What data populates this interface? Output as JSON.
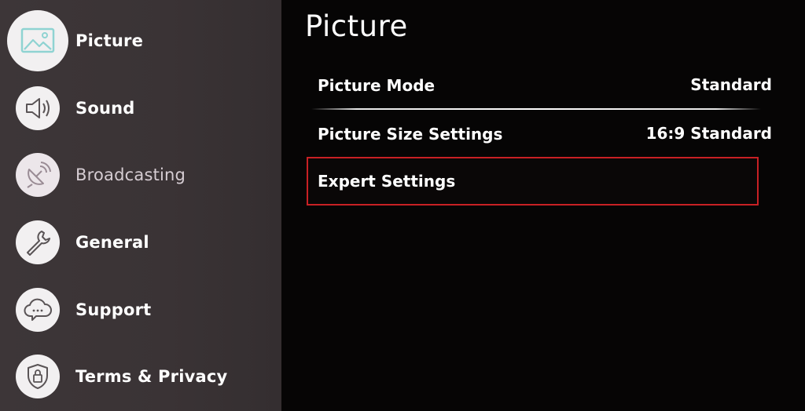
{
  "sidebar": {
    "items": [
      {
        "label": "Picture",
        "icon": "picture-icon",
        "state": "active"
      },
      {
        "label": "Sound",
        "icon": "speaker-icon",
        "state": "normal"
      },
      {
        "label": "Broadcasting",
        "icon": "satellite-dish-icon",
        "state": "dim"
      },
      {
        "label": "General",
        "icon": "wrench-icon",
        "state": "normal"
      },
      {
        "label": "Support",
        "icon": "cloud-chat-icon",
        "state": "normal"
      },
      {
        "label": "Terms & Privacy",
        "icon": "shield-icon",
        "state": "normal"
      }
    ]
  },
  "main": {
    "title": "Picture",
    "rows": [
      {
        "label": "Picture Mode",
        "value": "Standard"
      },
      {
        "label": "Picture Size Settings",
        "value": "16:9 Standard"
      },
      {
        "label": "Expert Settings",
        "value": "",
        "selected": true
      }
    ]
  },
  "colors": {
    "sidebar_bg": "#3a3335",
    "main_bg": "#060505",
    "focus_border": "#c82024",
    "text": "#ffffff",
    "dim_text": "#d6cdd3"
  }
}
